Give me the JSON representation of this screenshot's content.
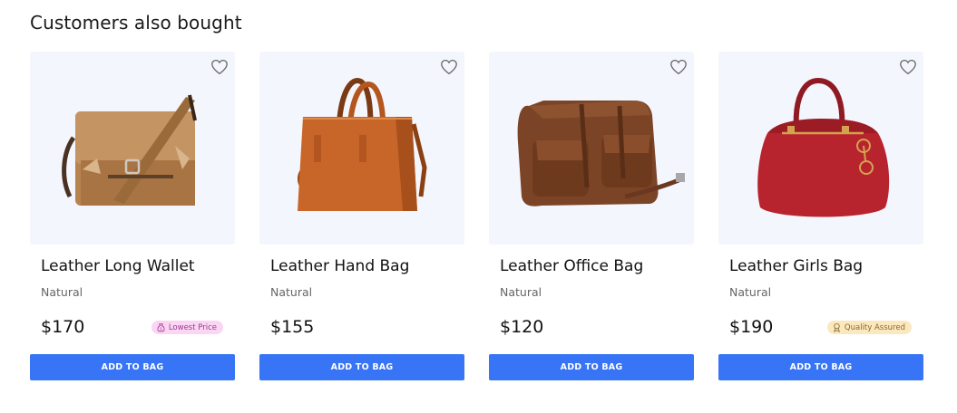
{
  "section": {
    "title": "Customers also bought"
  },
  "colors": {
    "card_bg": "#f4f6fd",
    "button": "#3774f6",
    "lowest_price_badge_bg": "#fbd5f4",
    "lowest_price_badge_text": "#9b3d8e",
    "quality_badge_bg": "#fbe8bf",
    "quality_badge_text": "#8a6a2c"
  },
  "products": [
    {
      "name": "Leather Long Wallet",
      "variant": "Natural",
      "price": "$170",
      "badge": {
        "label": "Lowest Price",
        "icon": "money-bag-icon"
      },
      "button_label": "ADD TO BAG",
      "image": "tan-messenger-bag"
    },
    {
      "name": "Leather Hand Bag",
      "variant": "Natural",
      "price": "$155",
      "badge": null,
      "button_label": "ADD TO BAG",
      "image": "orange-tote-bag"
    },
    {
      "name": "Leather Office Bag",
      "variant": "Natural",
      "price": "$120",
      "badge": null,
      "button_label": "ADD TO BAG",
      "image": "brown-office-bag"
    },
    {
      "name": "Leather Girls Bag",
      "variant": "Natural",
      "price": "$190",
      "badge": {
        "label": "Quality Assured",
        "icon": "award-icon"
      },
      "button_label": "ADD TO BAG",
      "image": "red-handbag"
    }
  ]
}
